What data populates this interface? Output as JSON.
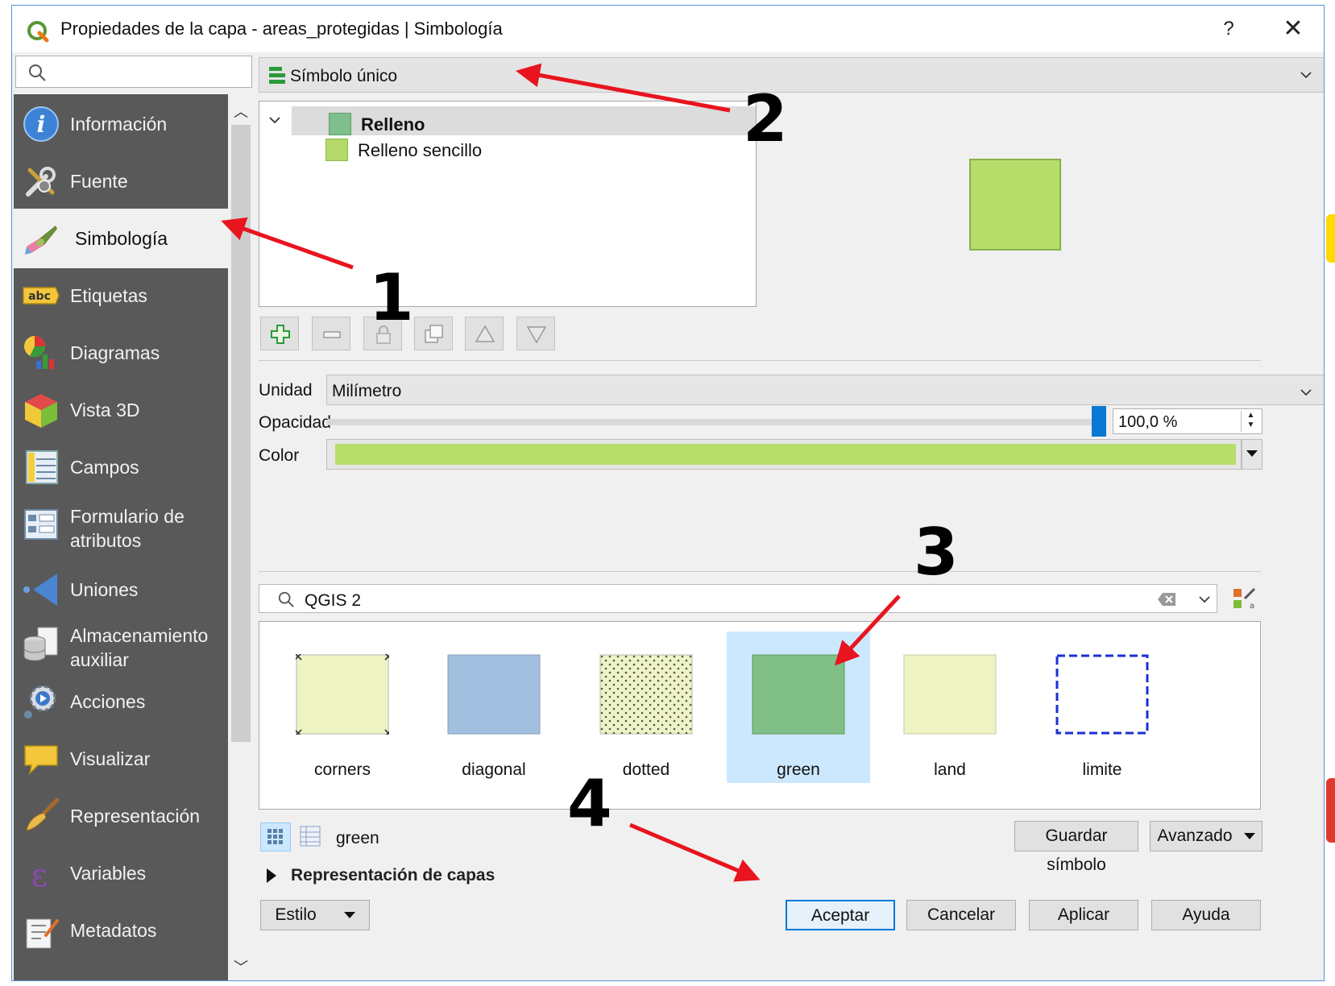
{
  "window": {
    "title": "Propiedades de la capa - areas_protegidas | Simbología",
    "help_label": "?",
    "close_label": "✕"
  },
  "sidebar": {
    "search_placeholder": "",
    "items": [
      {
        "label": "Información",
        "icon": "info-icon"
      },
      {
        "label": "Fuente",
        "icon": "tools-icon"
      },
      {
        "label": "Simbología",
        "icon": "paintbrush-icon",
        "active": true
      },
      {
        "label": "Etiquetas",
        "icon": "abc-label-icon"
      },
      {
        "label": "Diagramas",
        "icon": "diagram-icon"
      },
      {
        "label": "Vista 3D",
        "icon": "cube-icon"
      },
      {
        "label": "Campos",
        "icon": "fields-table-icon"
      },
      {
        "label": "Formulario de atributos",
        "icon": "form-icon"
      },
      {
        "label": "Uniones",
        "icon": "join-icon"
      },
      {
        "label": "Almacenamiento auxiliar",
        "icon": "database-icon"
      },
      {
        "label": "Acciones",
        "icon": "actions-gear-icon"
      },
      {
        "label": "Visualizar",
        "icon": "speech-bubble-icon"
      },
      {
        "label": "Representación",
        "icon": "brush-icon"
      },
      {
        "label": "Variables",
        "icon": "epsilon-icon"
      },
      {
        "label": "Metadatos",
        "icon": "metadata-icon"
      }
    ]
  },
  "renderer": {
    "selected": "Símbolo único"
  },
  "symbol_tree": {
    "root_label": "Relleno",
    "child_label": "Relleno sencillo",
    "root_color": "#7fbf8b",
    "child_color": "#b5da6a"
  },
  "preview": {
    "fill_color": "#b7dc6a"
  },
  "properties": {
    "unit_label": "Unidad",
    "unit_value": "Milímetro",
    "opacity_label": "Opacidad",
    "opacity_value": "100,0 %",
    "opacity_fraction": 1.0,
    "color_label": "Color",
    "color_value": "#b7dd6b"
  },
  "library": {
    "search_value": "QGIS 2",
    "symbols": [
      {
        "name": "corners",
        "fill": "#eef3c4",
        "style": "corners"
      },
      {
        "name": "diagonal",
        "fill": "#a3bfdf",
        "style": "solid"
      },
      {
        "name": "dotted",
        "fill": "#eef3c4",
        "style": "dotted"
      },
      {
        "name": "green",
        "fill": "#80bf86",
        "style": "solid",
        "selected": true
      },
      {
        "name": "land",
        "fill": "#eef3c4",
        "style": "solid"
      },
      {
        "name": "limite",
        "fill": "#ffffff",
        "style": "dashed"
      }
    ],
    "selected_name": "green",
    "save_symbol_label": "Guardar símbolo",
    "advanced_label": "Avanzado"
  },
  "layer_rendering": {
    "label": "Representación de capas"
  },
  "footer": {
    "style_label": "Estilo",
    "ok_label": "Aceptar",
    "cancel_label": "Cancelar",
    "apply_label": "Aplicar",
    "help_label": "Ayuda"
  },
  "annotations": [
    "1",
    "2",
    "3",
    "4"
  ]
}
